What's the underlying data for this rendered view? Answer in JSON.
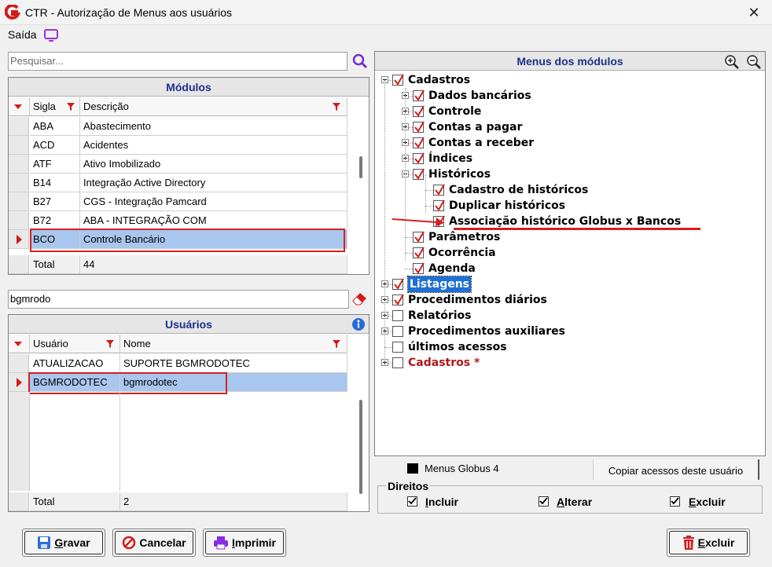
{
  "window": {
    "title": "CTR - Autorização de Menus aos usuários",
    "close_glyph": "✕"
  },
  "menubar": {
    "saida": "Saída"
  },
  "search": {
    "placeholder": "Pesquisar..."
  },
  "modulos": {
    "title": "Módulos",
    "col_sigla": "Sigla",
    "col_descricao": "Descrição",
    "rows": [
      {
        "sigla": "ABA",
        "descricao": "Abastecimento"
      },
      {
        "sigla": "ACD",
        "descricao": "Acidentes"
      },
      {
        "sigla": "ATF",
        "descricao": "Ativo Imobilizado"
      },
      {
        "sigla": "B14",
        "descricao": "Integração Active Directory"
      },
      {
        "sigla": "B27",
        "descricao": "CGS - Integração Pamcard"
      },
      {
        "sigla": "B72",
        "descricao": "ABA - INTEGRAÇÃO COM"
      },
      {
        "sigla": "BCO",
        "descricao": "Controle Bancário"
      }
    ],
    "total_label": "Total",
    "total_value": "44"
  },
  "user_filter": {
    "value": "bgmrodo"
  },
  "usuarios": {
    "title": "Usuários",
    "col_usuario": "Usuário",
    "col_nome": "Nome",
    "rows": [
      {
        "usuario": "ATUALIZACAO",
        "nome": "SUPORTE BGMRODOTEC"
      },
      {
        "usuario": "BGMRODOTEC",
        "nome": "bgmrodotec"
      }
    ],
    "total_label": "Total",
    "total_value": "2"
  },
  "menus": {
    "title": "Menus dos módulos",
    "tree": [
      {
        "label": "Cadastros",
        "level": 0,
        "expander": "minus",
        "checked": true
      },
      {
        "label": "Dados bancários",
        "level": 1,
        "expander": "plus",
        "checked": true
      },
      {
        "label": "Controle",
        "level": 1,
        "expander": "plus",
        "checked": true
      },
      {
        "label": "Contas a pagar",
        "level": 1,
        "expander": "plus",
        "checked": true
      },
      {
        "label": "Contas a receber",
        "level": 1,
        "expander": "plus",
        "checked": true
      },
      {
        "label": "Índices",
        "level": 1,
        "expander": "plus",
        "checked": true
      },
      {
        "label": "Históricos",
        "level": 1,
        "expander": "minus",
        "checked": true
      },
      {
        "label": "Cadastro de históricos",
        "level": 2,
        "expander": "none",
        "checked": true
      },
      {
        "label": "Duplicar históricos",
        "level": 2,
        "expander": "none",
        "checked": true
      },
      {
        "label": "Associação histórico Globus x Bancos",
        "level": 2,
        "expander": "none",
        "checked": true
      },
      {
        "label": "Parâmetros",
        "level": 1,
        "expander": "none",
        "checked": true
      },
      {
        "label": "Ocorrência",
        "level": 1,
        "expander": "none",
        "checked": true
      },
      {
        "label": "Agenda",
        "level": 1,
        "expander": "none",
        "checked": true
      },
      {
        "label": "Listagens",
        "level": 0,
        "expander": "plus",
        "checked": true
      },
      {
        "label": "Procedimentos diários",
        "level": 0,
        "expander": "plus",
        "checked": true
      },
      {
        "label": "Relatórios",
        "level": 0,
        "expander": "plus",
        "checked": false
      },
      {
        "label": "Procedimentos auxiliares",
        "level": 0,
        "expander": "plus",
        "checked": false
      },
      {
        "label": "últimos acessos",
        "level": 0,
        "expander": "none",
        "checked": false
      },
      {
        "label": "Cadastros *",
        "level": 0,
        "expander": "plus",
        "checked": false
      }
    ]
  },
  "legend": {
    "label": "Menus Globus 4"
  },
  "copy_button": "Copiar acessos deste usuário",
  "direitos": {
    "title": "Direitos",
    "incluir": "Incluir",
    "alterar": "Alterar",
    "excluir": "Excluir"
  },
  "buttons": {
    "gravar": "Gravar",
    "cancelar": "Cancelar",
    "imprimir": "Imprimir",
    "excluir": "Excluir"
  },
  "colors": {
    "accent_red": "#d01c1c",
    "title_blue": "#1c2f8c",
    "selection": "#a9c6ee"
  }
}
